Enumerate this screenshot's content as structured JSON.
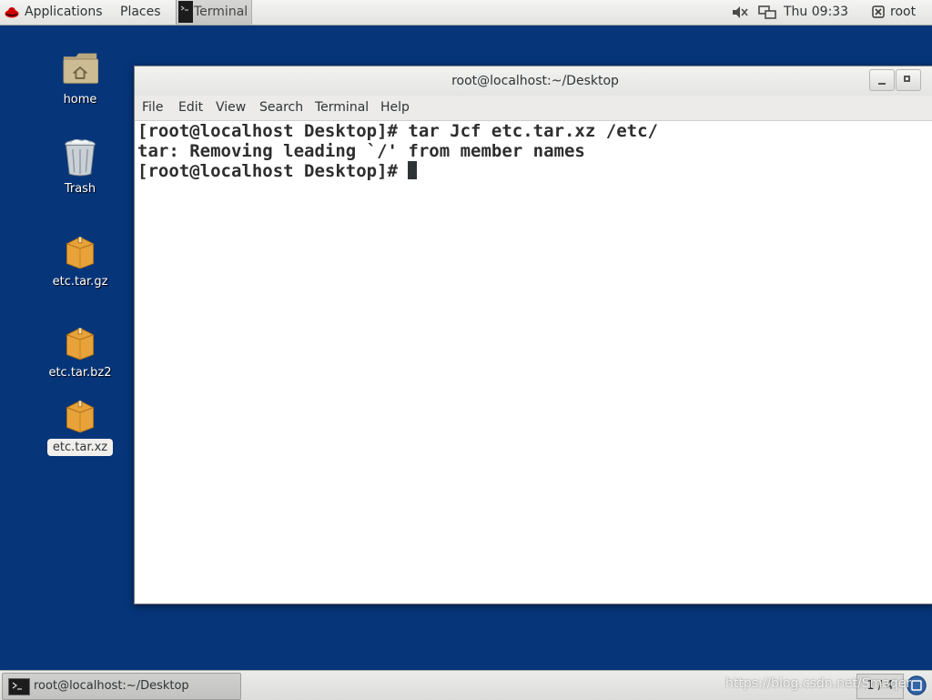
{
  "top_panel": {
    "applications_label": "Applications",
    "places_label": "Places",
    "active_app_label": "Terminal",
    "clock": "Thu 09:33",
    "user": "root"
  },
  "desktop_icons": [
    {
      "label": "home",
      "icon": "home-folder-icon"
    },
    {
      "label": "Trash",
      "icon": "trash-icon"
    },
    {
      "label": "etc.tar.gz",
      "icon": "archive-icon"
    },
    {
      "label": "etc.tar.bz2",
      "icon": "archive-icon"
    },
    {
      "label": "etc.tar.xz",
      "icon": "archive-icon",
      "selected": true
    }
  ],
  "window": {
    "title": "root@localhost:~/Desktop",
    "menu": [
      "File",
      "Edit",
      "View",
      "Search",
      "Terminal",
      "Help"
    ],
    "lines": [
      "[root@localhost Desktop]# tar Jcf etc.tar.xz /etc/",
      "tar: Removing leading `/' from member names",
      "[root@localhost Desktop]# "
    ]
  },
  "bottom_panel": {
    "task_label": "root@localhost:~/Desktop",
    "workspace": "1 / 4",
    "watermark": "https://blog.csdn.net/Smaqer"
  },
  "colors": {
    "desktop_bg": "#06357a",
    "terminal_text": "#2e2e2e"
  }
}
